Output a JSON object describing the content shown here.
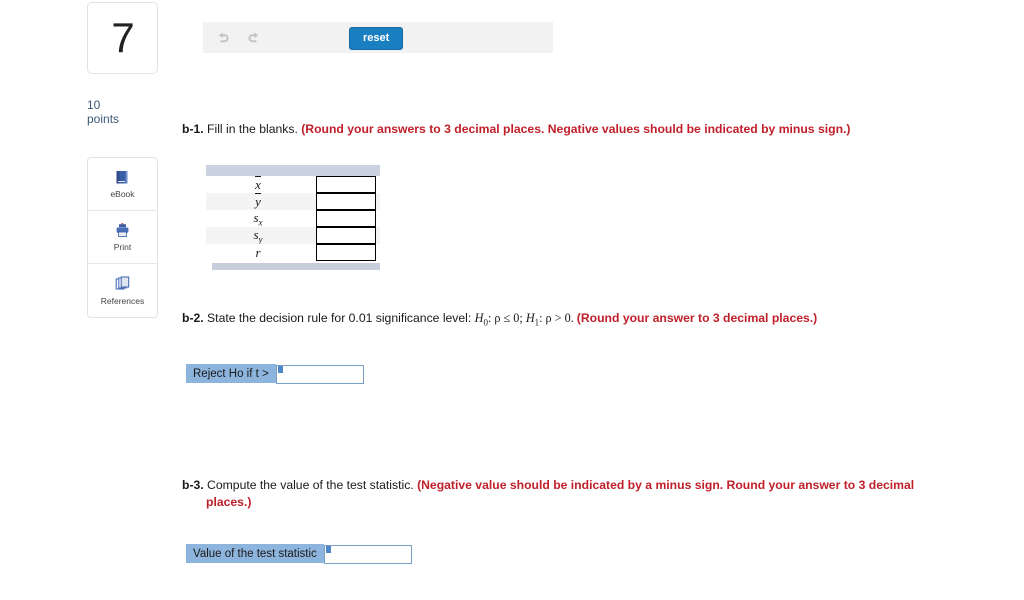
{
  "question": {
    "number": "7",
    "points_value": "10",
    "points_label": "points"
  },
  "toolbar": {
    "undo_icon": "undo-arrow-icon",
    "redo_icon": "redo-arrow-icon",
    "reset_label": "reset"
  },
  "sidebar": {
    "items": [
      {
        "label": "eBook",
        "icon": "book-icon"
      },
      {
        "label": "Print",
        "icon": "printer-icon"
      },
      {
        "label": "References",
        "icon": "copy-pages-icon"
      }
    ]
  },
  "parts": {
    "b1": {
      "lead": "b-1.",
      "prompt": " Fill in the blanks. ",
      "note": "(Round your answers to 3 decimal places. Negative values should be indicated by minus sign.)"
    },
    "b2": {
      "lead": "b-2.",
      "prompt_before": " State the decision rule for 0.01 significance level: ",
      "h0_sym": "H",
      "h0_sub": "0",
      "h0_rest": ": ρ ≤ 0; ",
      "h1_sym": "H",
      "h1_sub": "1",
      "h1_rest": ": ρ > 0. ",
      "note": "(Round your answer to 3 decimal places.)",
      "answer_label": "Reject Ho if t >",
      "answer_value": "",
      "answer_placeholder": ""
    },
    "b3": {
      "lead": "b-3.",
      "prompt": " Compute the value of the test statistic. ",
      "note_line1": "(Negative value should be indicated by a minus sign. Round your answer to 3 decimal",
      "note_line2": "places.)",
      "answer_label": "Value of the test statistic",
      "answer_value": "",
      "answer_placeholder": ""
    }
  },
  "stats_table": {
    "rows": [
      {
        "symbol": "x",
        "overline": true,
        "sub": "",
        "value": ""
      },
      {
        "symbol": "y",
        "overline": true,
        "sub": "",
        "value": ""
      },
      {
        "symbol": "s",
        "overline": false,
        "sub": "x",
        "value": ""
      },
      {
        "symbol": "s",
        "overline": false,
        "sub": "y",
        "value": ""
      },
      {
        "symbol": "r",
        "overline": false,
        "sub": "",
        "value": ""
      }
    ]
  },
  "colors": {
    "accent_blue": "#1a7fc1",
    "label_blue": "#8cb4dc",
    "note_red": "#c0202a",
    "bar_blue_gray": "#ccd3e0",
    "points_text": "#3c5a78"
  }
}
